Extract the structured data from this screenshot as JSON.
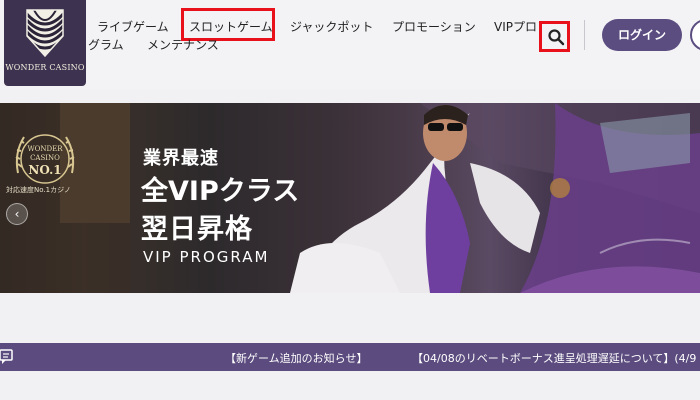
{
  "logo": {
    "text": "WONDER CASINO",
    "icon": "swirl-logo-icon"
  },
  "nav": {
    "items": [
      {
        "label": "ライブゲーム"
      },
      {
        "label": "スロットゲーム",
        "highlighted": true
      },
      {
        "label": "ジャックポット"
      },
      {
        "label": "プロモーション"
      },
      {
        "label": "VIPプロ"
      },
      {
        "label": "グラム"
      },
      {
        "label": "メンテナンス"
      }
    ]
  },
  "search": {
    "icon": "search-icon",
    "highlighted": true
  },
  "login": {
    "label": "ログイン"
  },
  "banner": {
    "medal_lines": [
      "WONDER",
      "CASINO",
      "NO.1"
    ],
    "medal_caption": "対応速度No.1カジノ",
    "line1": "業界最速",
    "line2": "全VIPクラス",
    "line3": "翌日昇格",
    "line4": "VIP PROGRAM",
    "prev_icon": "chevron-left-icon"
  },
  "ticker": {
    "icon": "chat-icon",
    "items": [
      "【新ゲーム追加のお知らせ】",
      "【04/08のリベートボーナス進呈処理遅延について】(4/9"
    ]
  },
  "colors": {
    "brand_purple": "#5c4d81",
    "ticker_bg": "#5b4b7e",
    "highlight_red": "#e8101a",
    "logo_bg": "#3d3350"
  }
}
